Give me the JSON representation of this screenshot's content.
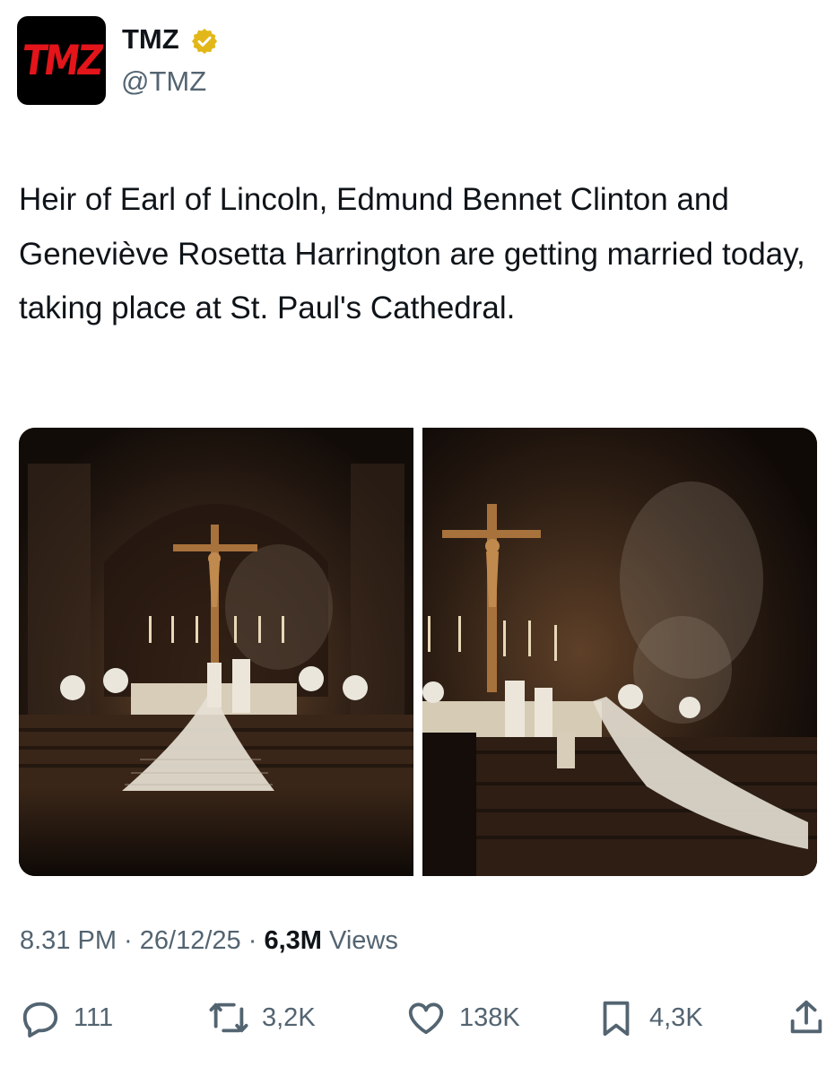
{
  "author": {
    "avatar_text": "TMZ",
    "name": "TMZ",
    "handle": "@TMZ",
    "verified_color": "#e2b719"
  },
  "tweet": {
    "text": "Heir of Earl of Lincoln, Edmund Bennet Clinton and Geneviève Rosetta Harrington are getting married today, taking place at St. Paul's Cathedral."
  },
  "media": [
    {
      "icon": "photo",
      "description_hidden": true
    },
    {
      "icon": "photo",
      "description_hidden": true
    }
  ],
  "meta": {
    "time": "8.31 PM",
    "separator": " · ",
    "date": "26/12/25",
    "views_count": "6,3M",
    "views_label": "Views"
  },
  "actions": {
    "replies": "111",
    "reposts": "3,2K",
    "likes": "138K",
    "bookmarks": "4,3K"
  },
  "colors": {
    "text": "#0f1419",
    "secondary": "#536471",
    "brand_red": "#e3141a"
  }
}
